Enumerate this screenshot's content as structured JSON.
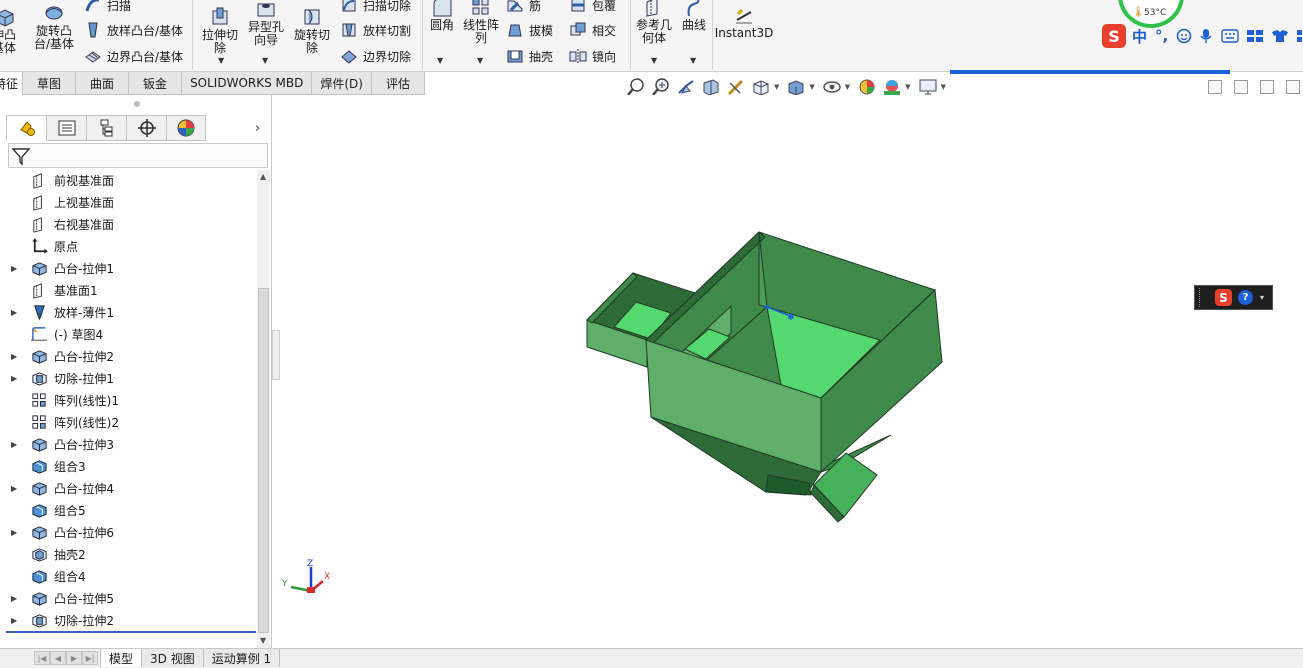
{
  "ribbon": {
    "buttons": [
      {
        "name": "extrude-boss-button",
        "label_lines": [
          "伸凸",
          "基体"
        ]
      },
      {
        "name": "revolve-boss-button",
        "label_lines": [
          "旋转凸",
          "台/基体"
        ]
      },
      {
        "name": "extrude-cut-button",
        "label_lines": [
          "拉伸切",
          "除"
        ]
      },
      {
        "name": "hole-wizard-button",
        "label_lines": [
          "异型孔",
          "向导"
        ]
      },
      {
        "name": "revolve-cut-button",
        "label_lines": [
          "旋转切",
          "除"
        ]
      },
      {
        "name": "fillet-button",
        "label_lines": [
          "圆角"
        ]
      },
      {
        "name": "linear-pattern-button",
        "label_lines": [
          "线性阵",
          "列"
        ]
      },
      {
        "name": "reference-geometry-button",
        "label_lines": [
          "参考几",
          "何体"
        ]
      },
      {
        "name": "curves-button",
        "label_lines": [
          "曲线"
        ]
      },
      {
        "name": "instant3d-button",
        "label_lines": [
          "Instant3D"
        ]
      }
    ],
    "rows": {
      "sweep": "扫描",
      "loft": "放样凸台/基体",
      "boundary": "边界凸台/基体",
      "swept_cut": "扫描切除",
      "lofted_cut": "放样切割",
      "boundary_cut": "边界切除",
      "rib": "筋",
      "draft": "拔模",
      "shell": "抽壳",
      "wrap": "包覆",
      "intersect": "相交",
      "mirror": "镜向"
    }
  },
  "temperature": "53°C",
  "ime": {
    "logo": "S",
    "mode": "中",
    "punct": "°,"
  },
  "tabs": [
    "特征",
    "草图",
    "曲面",
    "钣金",
    "SOLIDWORKS MBD",
    "焊件(D)",
    "评估"
  ],
  "tree": [
    {
      "label": "前视基准面",
      "icon": "plane",
      "expand": false
    },
    {
      "label": "上视基准面",
      "icon": "plane",
      "expand": false
    },
    {
      "label": "右视基准面",
      "icon": "plane",
      "expand": false
    },
    {
      "label": "原点",
      "icon": "origin",
      "expand": false
    },
    {
      "label": "凸台-拉伸1",
      "icon": "boss",
      "expand": true
    },
    {
      "label": "基准面1",
      "icon": "plane",
      "expand": false
    },
    {
      "label": "放样-薄件1",
      "icon": "loft",
      "expand": true
    },
    {
      "label": "(-) 草图4",
      "icon": "sketch",
      "expand": false
    },
    {
      "label": "凸台-拉伸2",
      "icon": "boss",
      "expand": true
    },
    {
      "label": "切除-拉伸1",
      "icon": "cut",
      "expand": true
    },
    {
      "label": "阵列(线性)1",
      "icon": "pattern",
      "expand": false
    },
    {
      "label": "阵列(线性)2",
      "icon": "pattern",
      "expand": false
    },
    {
      "label": "凸台-拉伸3",
      "icon": "boss",
      "expand": true
    },
    {
      "label": "组合3",
      "icon": "combine",
      "expand": false
    },
    {
      "label": "凸台-拉伸4",
      "icon": "boss",
      "expand": true
    },
    {
      "label": "组合5",
      "icon": "combine",
      "expand": false
    },
    {
      "label": "凸台-拉伸6",
      "icon": "boss",
      "expand": true
    },
    {
      "label": "抽壳2",
      "icon": "shell",
      "expand": false
    },
    {
      "label": "组合4",
      "icon": "combine",
      "expand": false
    },
    {
      "label": "凸台-拉伸5",
      "icon": "boss",
      "expand": true
    },
    {
      "label": "切除-拉伸2",
      "icon": "cut",
      "expand": true
    }
  ],
  "triad": {
    "x": "X",
    "y": "Y",
    "z": "Z"
  },
  "bottom_tabs": [
    "模型",
    "3D 视图",
    "运动算例 1"
  ],
  "colors": {
    "model_light": "#5fae6a",
    "model_mid": "#3f8a4b",
    "model_dark": "#2e6b38",
    "model_floor": "#55d870",
    "accent_blue": "#1d5fd8"
  }
}
